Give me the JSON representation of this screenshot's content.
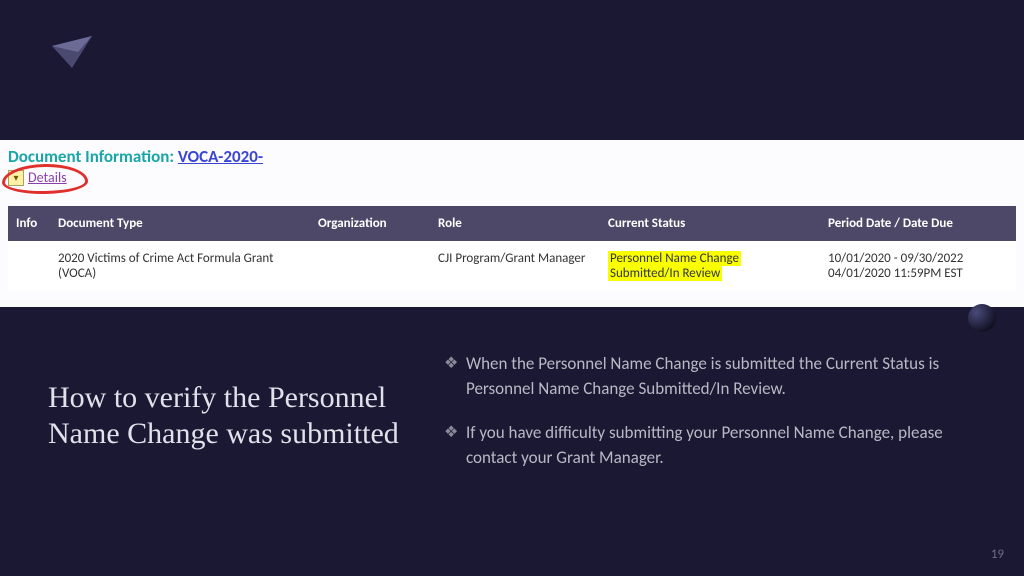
{
  "docInfo": {
    "label": "Document Information:",
    "link": "VOCA-2020-"
  },
  "details": {
    "label": "Details"
  },
  "table": {
    "headers": {
      "info": "Info",
      "docType": "Document Type",
      "org": "Organization",
      "role": "Role",
      "status": "Current Status",
      "date": "Period Date / Date Due"
    },
    "row": {
      "docType": "2020 Victims of Crime Act Formula Grant (VOCA)",
      "org": "",
      "role": "CJI Program/Grant Manager",
      "statusLine1": "Personnel Name Change",
      "statusLine2": "Submitted/In Review",
      "dateLine1": "10/01/2020 - 09/30/2022",
      "dateLine2": "04/01/2020 11:59PM EST"
    }
  },
  "title": "How to verify the Personnel Name Change was submitted",
  "bullets": {
    "b1": "When the Personnel Name Change is submitted the Current Status is Personnel Name Change Submitted/In Review.",
    "b2": "If you have difficulty submitting your Personnel Name Change, please contact your Grant Manager."
  },
  "pageNumber": "19"
}
